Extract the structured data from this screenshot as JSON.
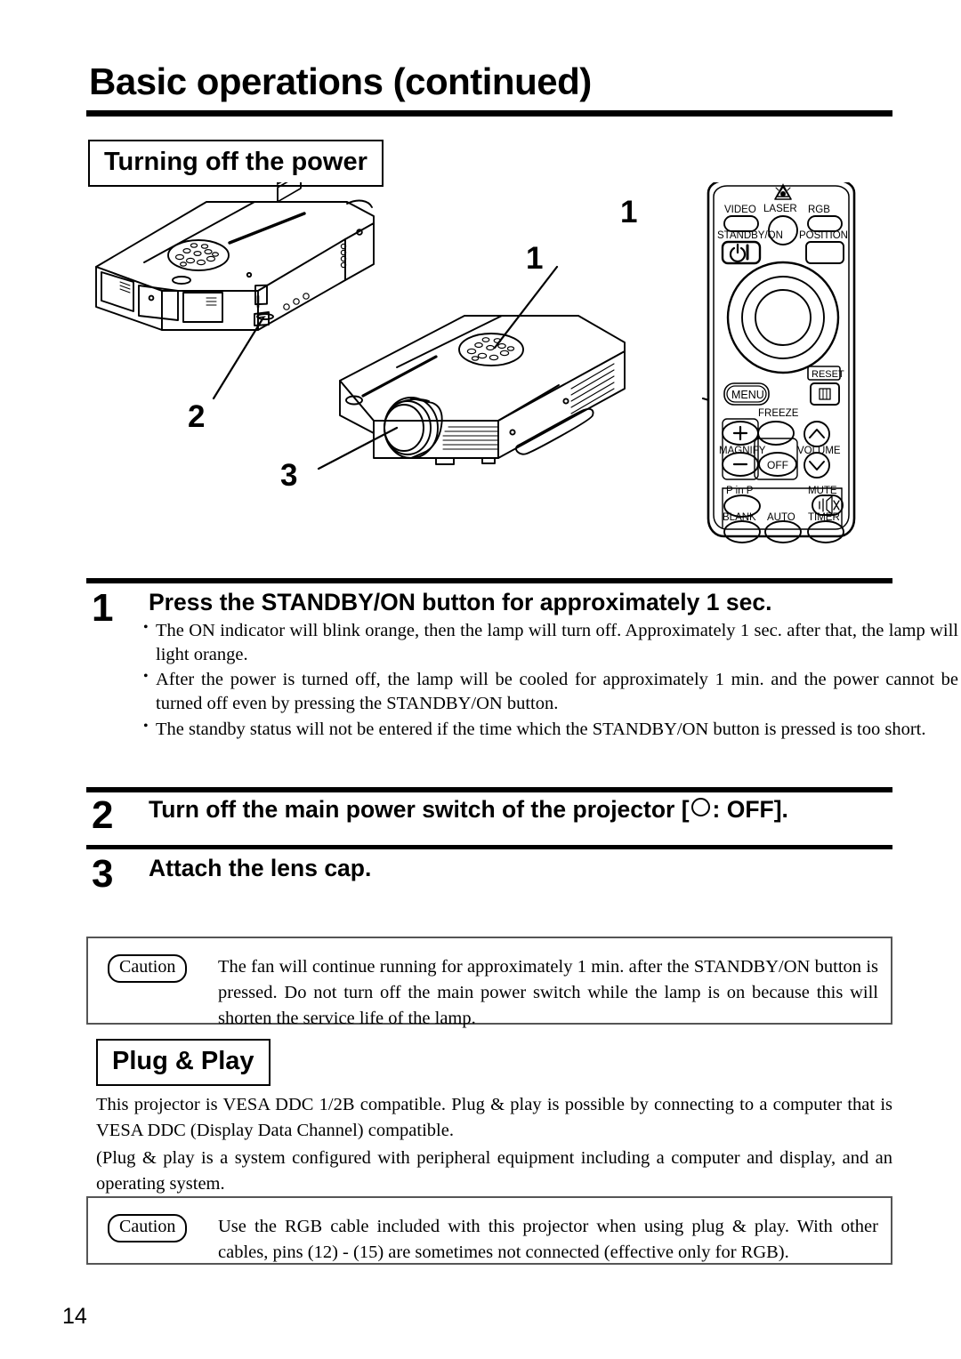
{
  "document": {
    "title": "Basic operations (continued)",
    "page_number": "14"
  },
  "sections": {
    "turning_off": "Turning off the power",
    "plug_play": "Plug & Play"
  },
  "figure": {
    "callouts": {
      "panel": "1",
      "remote": "1",
      "power_switch": "2",
      "lens": "3"
    },
    "remote": {
      "buttons": {
        "video": "VIDEO",
        "laser": "LASER",
        "rgb": "RGB",
        "standby_on": "STANDBY/ON",
        "position": "POSITION",
        "reset": "RESET",
        "menu": "MENU",
        "freeze": "FREEZE",
        "magnify": "MAGNIFY",
        "volume": "VOLUME",
        "off": "OFF",
        "magnify_plus": "+",
        "magnify_minus": "−",
        "p_in_p": "P in P",
        "mute": "MUTE",
        "blank": "BLANK",
        "auto": "AUTO",
        "timer": "TIMER"
      }
    }
  },
  "steps": [
    {
      "number": "1",
      "heading": "Press the STANDBY/ON button for approximately 1 sec.",
      "bullets": [
        "The ON indicator will blink orange, then the lamp will turn off. Approximately 1 sec. after that, the lamp will light orange.",
        "After the power is turned off, the lamp will be cooled for approximately 1 min. and the power cannot be turned off even by pressing the STANDBY/ON button.",
        "The standby status will not be entered if the time which the STANDBY/ON button is pressed is too short."
      ]
    },
    {
      "number": "2",
      "heading_before": "Turn off the main power switch of the projector [",
      "heading_after": ": OFF].",
      "bullets": []
    },
    {
      "number": "3",
      "heading": "Attach the lens cap.",
      "bullets": []
    }
  ],
  "cautions": [
    {
      "tag": "Caution",
      "text": "The fan will continue running for approximately 1 min. after the STANDBY/ON button is pressed. Do not turn off the main power switch while the lamp is on because this will shorten the service life of the lamp."
    },
    {
      "tag": "Caution",
      "text": "Use the RGB cable included with this projector when using plug & play. With other cables, pins (12) - (15) are sometimes not connected (effective only for RGB)."
    }
  ],
  "plug_play_body": [
    "This projector is VESA DDC 1/2B compatible. Plug & play is possible by connecting to a computer that is VESA DDC (Display Data Channel) compatible.",
    "(Plug & play is a system configured with peripheral equipment including a computer and display, and an operating system."
  ]
}
